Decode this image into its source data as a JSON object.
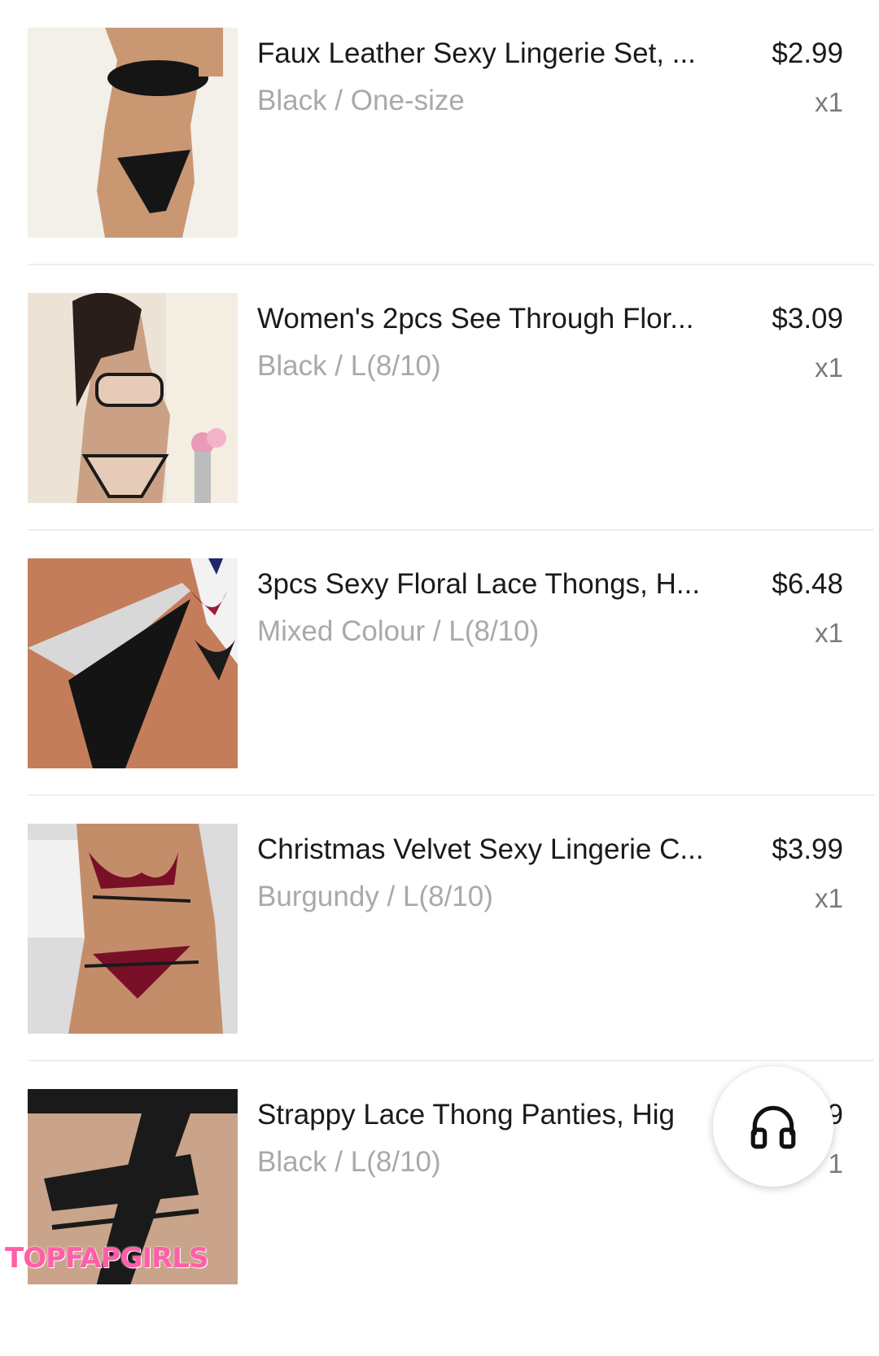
{
  "items": [
    {
      "title": "Faux Leather Sexy Lingerie Set, ...",
      "variant": "Black / One-size",
      "price": "$2.99",
      "quantity": "x1"
    },
    {
      "title": "Women's 2pcs See Through Flor...",
      "variant": "Black / L(8/10)",
      "price": "$3.09",
      "quantity": "x1"
    },
    {
      "title": "3pcs Sexy Floral Lace Thongs, H...",
      "variant": "Mixed Colour / L(8/10)",
      "price": "$6.48",
      "quantity": "x1"
    },
    {
      "title": "Christmas Velvet Sexy Lingerie C...",
      "variant": "Burgundy / L(8/10)",
      "price": "$3.99",
      "quantity": "x1"
    },
    {
      "title": "Strappy Lace Thong Panties, Hig",
      "variant": "Black / L(8/10)",
      "price": "9",
      "quantity": "1"
    }
  ],
  "support_button": {
    "icon": "headphones-icon"
  },
  "watermark": "TOPFAPGIRLS",
  "colors": {
    "title_text": "#1a1a1a",
    "variant_text": "#a9a9a9",
    "quantity_text": "#7a7a7a",
    "divider": "#eeeeee",
    "watermark": "#ff5fa8"
  }
}
